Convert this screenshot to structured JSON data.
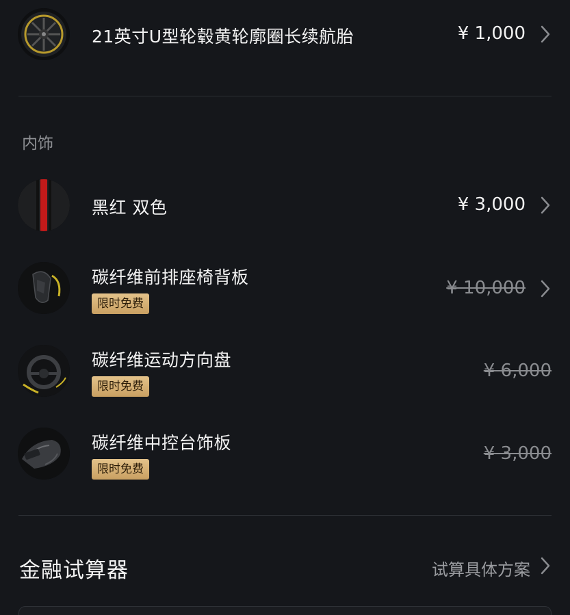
{
  "options": [
    {
      "title": "21英寸U型轮毂黄轮廓圈长续航胎",
      "price": "¥ 1,000",
      "strike": false,
      "arrow": true
    },
    {
      "title": "黑红 双色",
      "price": "¥ 3,000",
      "strike": false,
      "arrow": true
    },
    {
      "title": "碳纤维前排座椅背板",
      "badge": "限时免费",
      "price": "¥ 10,000",
      "strike": true,
      "arrow": true
    },
    {
      "title": "碳纤维运动方向盘",
      "badge": "限时免费",
      "price": "¥ 6,000",
      "strike": true,
      "arrow": false
    },
    {
      "title": "碳纤维中控台饰板",
      "badge": "限时免费",
      "price": "¥ 3,000",
      "strike": true,
      "arrow": false
    }
  ],
  "interior_label": "内饰",
  "finance": {
    "title": "金融试算器",
    "link": "试算具体方案"
  },
  "colors": {
    "background": "#15171b",
    "badge_gold": "#d8b57a",
    "muted": "#8d8f93"
  },
  "icons": {
    "chevron": "chevron-right-icon"
  }
}
